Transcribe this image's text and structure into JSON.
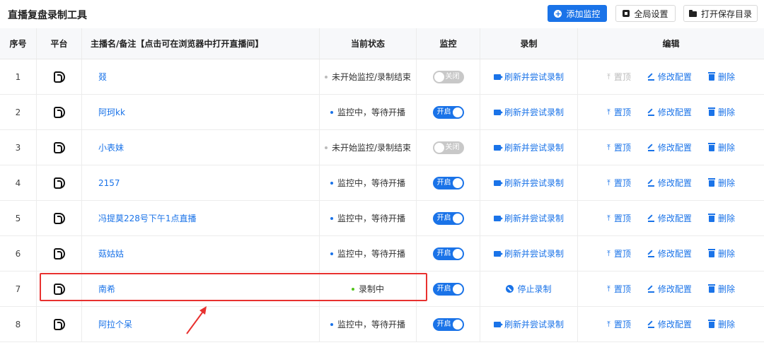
{
  "header": {
    "title": "直播复盘录制工具",
    "add_button": "添加监控",
    "settings_button": "全局设置",
    "open_dir_button": "打开保存目录"
  },
  "columns": {
    "index": "序号",
    "platform": "平台",
    "name": "主播名/备注【点击可在浏览器中打开直播间】",
    "status": "当前状态",
    "monitor": "监控",
    "record": "录制",
    "edit": "编辑"
  },
  "rows": [
    {
      "index": "1",
      "name": "叕",
      "status": "未开始监控/录制结束",
      "status_color": "grey",
      "monitor": "off",
      "monitor_label": "关闭",
      "record": "刷新并尝试录制",
      "record_icon": "camera-icon",
      "pin": "置顶",
      "pin_disabled": true,
      "edit": "修改配置",
      "delete": "删除"
    },
    {
      "index": "2",
      "name": "阿珂kk",
      "status": "监控中，等待开播",
      "status_color": "blue",
      "monitor": "on",
      "monitor_label": "开启",
      "record": "刷新并尝试录制",
      "record_icon": "camera-icon",
      "pin": "置顶",
      "pin_disabled": false,
      "edit": "修改配置",
      "delete": "删除"
    },
    {
      "index": "3",
      "name": "小表妹",
      "status": "未开始监控/录制结束",
      "status_color": "grey",
      "monitor": "off",
      "monitor_label": "关闭",
      "record": "刷新并尝试录制",
      "record_icon": "camera-icon",
      "pin": "置顶",
      "pin_disabled": false,
      "edit": "修改配置",
      "delete": "删除"
    },
    {
      "index": "4",
      "name": "2157",
      "status": "监控中，等待开播",
      "status_color": "blue",
      "monitor": "on",
      "monitor_label": "开启",
      "record": "刷新并尝试录制",
      "record_icon": "camera-icon",
      "pin": "置顶",
      "pin_disabled": false,
      "edit": "修改配置",
      "delete": "删除"
    },
    {
      "index": "5",
      "name": "冯提莫228号下午1点直播",
      "status": "监控中，等待开播",
      "status_color": "blue",
      "monitor": "on",
      "monitor_label": "开启",
      "record": "刷新并尝试录制",
      "record_icon": "camera-icon",
      "pin": "置顶",
      "pin_disabled": false,
      "edit": "修改配置",
      "delete": "删除"
    },
    {
      "index": "6",
      "name": "菇姑姑",
      "status": "监控中，等待开播",
      "status_color": "blue",
      "monitor": "on",
      "monitor_label": "开启",
      "record": "刷新并尝试录制",
      "record_icon": "camera-icon",
      "pin": "置顶",
      "pin_disabled": false,
      "edit": "修改配置",
      "delete": "删除"
    },
    {
      "index": "7",
      "name": "南希",
      "status": "录制中",
      "status_color": "green",
      "monitor": "on",
      "monitor_label": "开启",
      "record": "停止录制",
      "record_icon": "stop-icon",
      "pin": "置顶",
      "pin_disabled": false,
      "edit": "修改配置",
      "delete": "删除"
    },
    {
      "index": "8",
      "name": "阿拉个呆",
      "status": "监控中，等待开播",
      "status_color": "blue",
      "monitor": "on",
      "monitor_label": "开启",
      "record": "刷新并尝试录制",
      "record_icon": "camera-icon",
      "pin": "置顶",
      "pin_disabled": false,
      "edit": "修改配置",
      "delete": "删除"
    }
  ],
  "colors": {
    "accent": "#1a73e8",
    "highlight": "#e8312f",
    "status_grey": "#bbbbbb",
    "status_green": "#52c41a"
  }
}
